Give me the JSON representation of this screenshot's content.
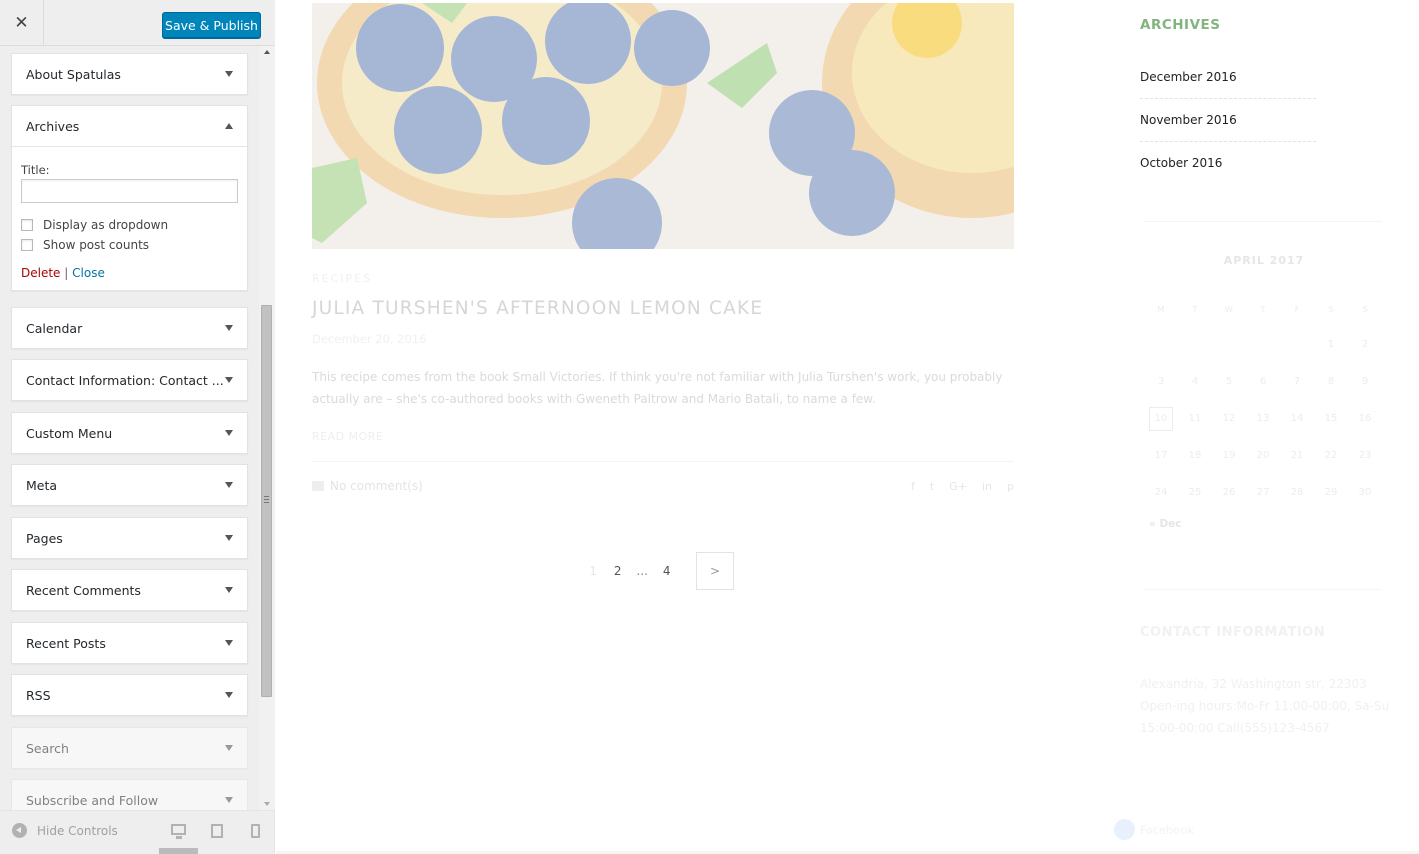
{
  "header": {
    "close_symbol": "✕",
    "publish_label": "Save & Publish"
  },
  "widgets": [
    {
      "label": "About Spatulas"
    },
    {
      "label": "Archives"
    },
    {
      "label": "Calendar"
    },
    {
      "label": "Contact Information: Contact ..."
    },
    {
      "label": "Custom Menu"
    },
    {
      "label": "Meta"
    },
    {
      "label": "Pages"
    },
    {
      "label": "Recent Comments"
    },
    {
      "label": "Recent Posts"
    },
    {
      "label": "RSS"
    },
    {
      "label": "Search"
    },
    {
      "label": "Subscribe and Follow"
    }
  ],
  "archives_form": {
    "title_label": "Title:",
    "title_value": "",
    "dropdown_label": "Display as dropdown",
    "dropdown_checked": false,
    "counts_label": "Show post counts",
    "counts_checked": false,
    "delete_label": "Delete",
    "separator": "|",
    "close_label": "Close"
  },
  "footer": {
    "hide_controls_label": "Hide Controls"
  },
  "post": {
    "category": "RECIPES",
    "title": "JULIA TURSHEN'S AFTERNOON LEMON CAKE",
    "date": "December 20, 2016",
    "excerpt": "This recipe comes from the book Small Victories. If think you're not familiar with Julia Turshen's work, you probably actually are – she's co-authored books with Gweneth Paltrow and Mario Batali, to name a few.",
    "read_more": "READ MORE",
    "comments": "No comment(s)",
    "social": [
      "f",
      "t",
      "G+",
      "in",
      "p"
    ]
  },
  "pagination": {
    "pages": [
      "1",
      "2",
      "...",
      "4"
    ],
    "current": "1",
    "next_symbol": ">"
  },
  "archives_widget": {
    "title": "ARCHIVES",
    "items": [
      "December 2016",
      "November 2016",
      "October 2016"
    ]
  },
  "calendar": {
    "title": "APRIL 2017",
    "weekdays": [
      "M",
      "T",
      "W",
      "T",
      "F",
      "S",
      "S"
    ],
    "weeks": [
      [
        "",
        "",
        "",
        "",
        "",
        "1",
        "2"
      ],
      [
        "3",
        "4",
        "5",
        "6",
        "7",
        "8",
        "9"
      ],
      [
        "10",
        "11",
        "12",
        "13",
        "14",
        "15",
        "16"
      ],
      [
        "17",
        "18",
        "19",
        "20",
        "21",
        "22",
        "23"
      ],
      [
        "24",
        "25",
        "26",
        "27",
        "28",
        "29",
        "30"
      ]
    ],
    "today": "10",
    "prev_label": "« Dec"
  },
  "contact": {
    "title": "CONTACT INFORMATION",
    "text": "Alexandria, 32 Washington str, 22303 Open-ing hours:Mo-Fr 11:00-00:00, Sa-Su 15:00-00:00 Call(555)123-4567"
  },
  "facebook_label": "Facebook",
  "colors": {
    "accent": "#0085ba",
    "archives_title": "#82b47f",
    "delete": "#aa0000",
    "link": "#0073aa"
  }
}
